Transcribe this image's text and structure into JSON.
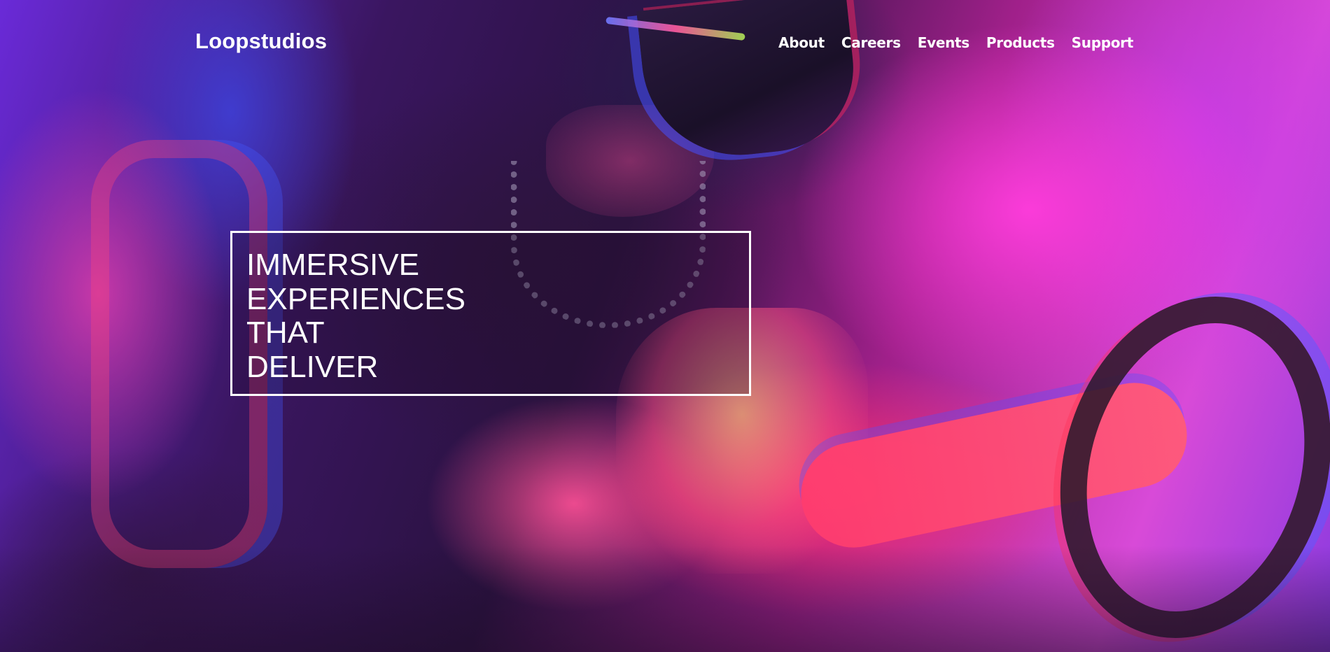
{
  "header": {
    "logo": "Loopstudios",
    "nav": [
      {
        "label": "About"
      },
      {
        "label": "Careers"
      },
      {
        "label": "Events"
      },
      {
        "label": "Products"
      },
      {
        "label": "Support"
      }
    ]
  },
  "hero": {
    "headline_lines": [
      "IMMERSIVE",
      "EXPERIENCES",
      "THAT",
      "DELIVER"
    ],
    "image": "person-in-vr-headset-driving-simulator"
  },
  "colors": {
    "magenta": "#ff3ce0",
    "hot_pink": "#ff3264",
    "blue": "#3c46e6",
    "dark_purple": "#2a1240",
    "text": "#ffffff"
  }
}
